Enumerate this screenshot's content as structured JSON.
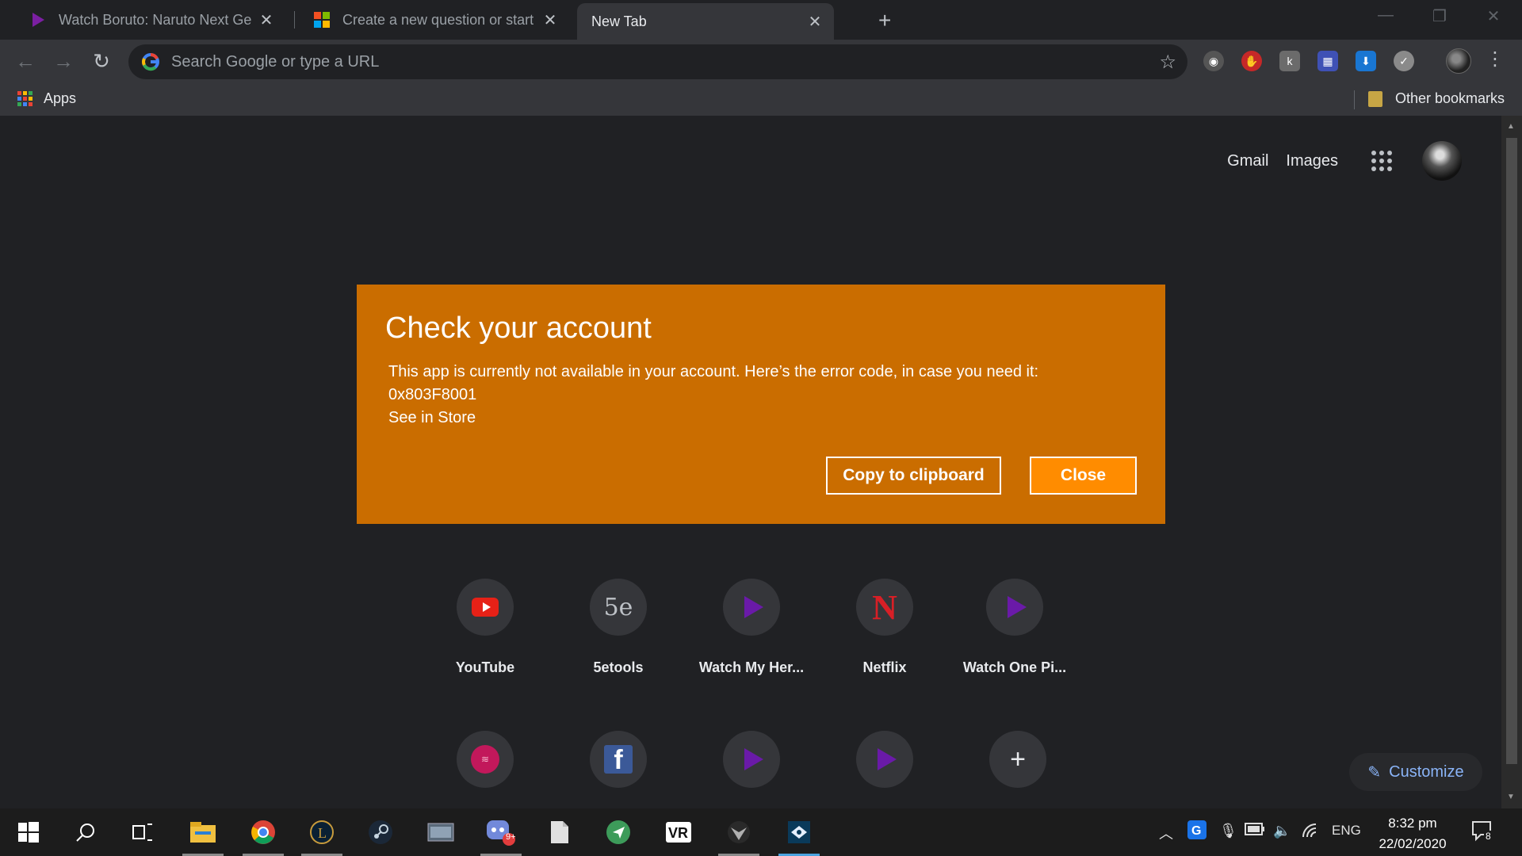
{
  "browser": {
    "tabs": [
      {
        "title": "Watch Boruto: Naruto Next Gene",
        "favicon": "play-purple-icon"
      },
      {
        "title": "Create a new question or start a",
        "favicon": "microsoft-logo-icon"
      },
      {
        "title": "New Tab",
        "favicon": "none"
      }
    ],
    "omnibox_placeholder": "Search Google or type a URL",
    "bookmarks": {
      "apps_label": "Apps",
      "other_label": "Other bookmarks"
    }
  },
  "ntp": {
    "header_links": [
      "Gmail",
      "Images"
    ],
    "tiles_row1": [
      {
        "label": "YouTube",
        "icon": "youtube-icon"
      },
      {
        "label": "5etools",
        "icon": "5etools-icon"
      },
      {
        "label": "Watch My Her...",
        "icon": "play-purple-icon"
      },
      {
        "label": "Netflix",
        "icon": "netflix-icon"
      },
      {
        "label": "Watch One Pi...",
        "icon": "play-purple-icon"
      }
    ],
    "tiles_row2": [
      {
        "icon": "pink-site-icon"
      },
      {
        "icon": "facebook-icon"
      },
      {
        "icon": "play-purple-icon"
      },
      {
        "icon": "play-purple-icon"
      },
      {
        "icon": "add-shortcut-icon"
      }
    ],
    "customize_label": "Customize"
  },
  "dialog": {
    "title": "Check your account",
    "message": "This app is currently not available in your account. Here’s the error code, in case you need it:",
    "error_code": "0x803F8001",
    "store_link": "See in Store",
    "copy_button": "Copy to clipboard",
    "close_button": "Close",
    "colors": {
      "background": "#ca6d00",
      "close_button": "#ff8c00"
    }
  },
  "taskbar": {
    "language": "ENG",
    "time": "8:32 pm",
    "date": "22/02/2020",
    "discord_badge": "9+",
    "notification_count": "8"
  }
}
